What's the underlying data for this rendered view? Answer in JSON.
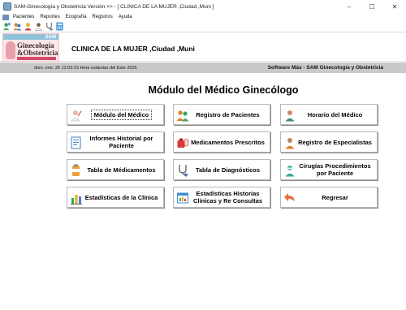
{
  "window": {
    "title": "SAM-Ginecología y Obstetricia Versión >> - [ CLINICA DE LA MUJER  ,Ciudad  ,Muni ]",
    "controls": {
      "minimize": "–",
      "maximize": "☐",
      "close": "✕"
    }
  },
  "menubar": {
    "items": [
      {
        "label": "Pacientes"
      },
      {
        "label": "Reportes"
      },
      {
        "label": "Ecografía"
      },
      {
        "label": "Registros"
      },
      {
        "label": "Ayuda"
      }
    ]
  },
  "toolbar": {
    "buttons": [
      {
        "icon": "add-patient-icon",
        "color": "#3aa55a"
      },
      {
        "icon": "patients-icon",
        "color": "#d9822b"
      },
      {
        "icon": "user-icon",
        "color": "#e0b020"
      },
      {
        "icon": "female-doctor-icon",
        "color": "#b0b0b0"
      },
      {
        "icon": "stethoscope-icon",
        "color": "#4a7fc1"
      },
      {
        "icon": "calculator-icon",
        "color": "#3b8fd4"
      }
    ]
  },
  "header": {
    "logo": {
      "badge": "SAM",
      "line1": "Ginecología",
      "line2": "&Obstetricia"
    },
    "clinic_name": "CLINICA DE LA MUJER  ,Ciudad  ,Muni"
  },
  "status": {
    "datetime": "dom. ene. 26 12:03:23 Hora estándar del Este 2025",
    "brand": "Software Más  - SAM Ginecología y Obstetricia"
  },
  "main": {
    "title": "Módulo del Médico Ginecólogo",
    "buttons": [
      {
        "label": "Módulo del Médico",
        "icon": "doctor-icon"
      },
      {
        "label": "Registro de Pacientes",
        "icon": "patients-group-icon"
      },
      {
        "label": "Horario del Médico",
        "icon": "doctor-schedule-icon"
      },
      {
        "label": "Informes Historial por Paciente",
        "icon": "report-icon"
      },
      {
        "label": "Medicamentos Prescritos",
        "icon": "medications-icon"
      },
      {
        "label": "Registro de Especialistas",
        "icon": "specialists-icon"
      },
      {
        "label": "Tabla de Médicamentos",
        "icon": "pills-table-icon"
      },
      {
        "label": "Tabla de Diagnósticos",
        "icon": "stethoscope-icon"
      },
      {
        "label": "Cirugías Procedimientos por Paciente",
        "icon": "surgery-icon"
      },
      {
        "label": "Estadísticas de la Clínica",
        "icon": "bar-chart-icon"
      },
      {
        "label": "Estadísticas Historias Clínicas y Re Consultas",
        "icon": "stats-records-icon"
      },
      {
        "label": "Regresar",
        "icon": "return-arrow-icon"
      }
    ]
  },
  "colors": {
    "status_band": "#c9c9c9",
    "logo_background": "#fde7ea",
    "button_border": "#b9b9b9"
  }
}
